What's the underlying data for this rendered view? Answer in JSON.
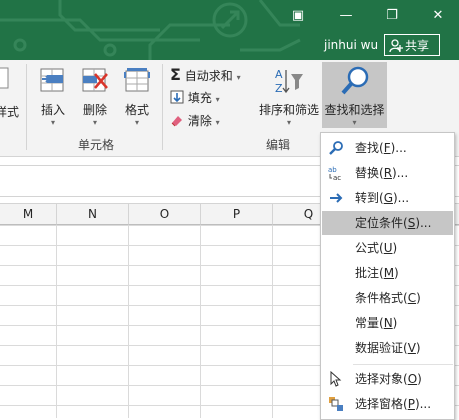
{
  "titlebar": {
    "user_name": "jinhui wu",
    "share_label": "共享",
    "icons": [
      "ribbon-display-icon",
      "minimize-icon",
      "restore-icon",
      "close-icon"
    ]
  },
  "ribbon": {
    "partial_label": "样式",
    "cells": {
      "insert": "插入",
      "delete": "删除",
      "format": "格式",
      "group": "单元格"
    },
    "edit": {
      "autosum": "自动求和",
      "fill": "填充",
      "clear": "清除",
      "sort_filter": "排序和筛选",
      "find_select": "查找和选择",
      "group": "编辑"
    }
  },
  "columns": [
    "M",
    "N",
    "O",
    "P",
    "Q"
  ],
  "menu": {
    "items": [
      {
        "label": "查找(F)...",
        "key": "F",
        "icon": "search-icon"
      },
      {
        "label": "替换(R)...",
        "key": "R",
        "icon": "replace-icon"
      },
      {
        "label": "转到(G)...",
        "key": "G",
        "icon": "arrow-right-icon"
      },
      {
        "label": "定位条件(S)...",
        "key": "S",
        "icon": "",
        "highlighted": true
      },
      {
        "label": "公式(U)",
        "key": "U",
        "icon": ""
      },
      {
        "label": "批注(M)",
        "key": "M",
        "icon": ""
      },
      {
        "label": "条件格式(C)",
        "key": "C",
        "icon": ""
      },
      {
        "label": "常量(N)",
        "key": "N",
        "icon": ""
      },
      {
        "label": "数据验证(V)",
        "key": "V",
        "icon": ""
      },
      {
        "label": "选择对象(O)",
        "key": "O",
        "icon": "select-objects-icon"
      },
      {
        "label": "选择窗格(P)...",
        "key": "P",
        "icon": "selection-pane-icon"
      }
    ]
  },
  "colors": {
    "excel_green": "#217346",
    "ribbon_bg": "#f3f3f3",
    "highlight": "#c6c6c6"
  }
}
